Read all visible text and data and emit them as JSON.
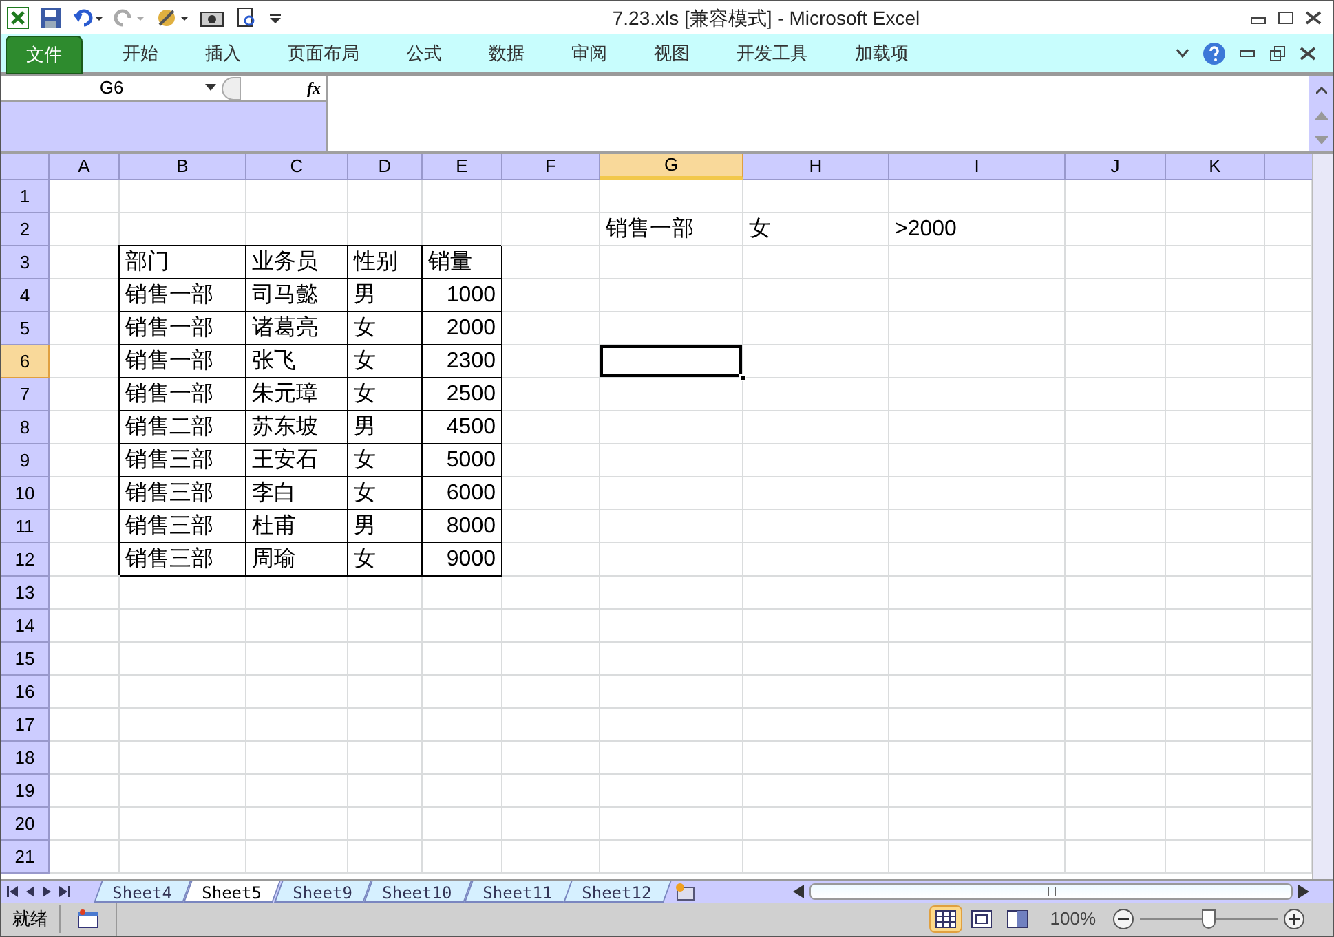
{
  "window": {
    "title": "7.23.xls  [兼容模式]  -  Microsoft Excel"
  },
  "ribbon": {
    "tabs": [
      {
        "label": "文件",
        "kind": "file"
      },
      {
        "label": "开始",
        "kind": "tab"
      },
      {
        "label": "插入",
        "kind": "tab"
      },
      {
        "label": "页面布局",
        "kind": "tab"
      },
      {
        "label": "公式",
        "kind": "tab"
      },
      {
        "label": "数据",
        "kind": "tab"
      },
      {
        "label": "审阅",
        "kind": "tab"
      },
      {
        "label": "视图",
        "kind": "tab"
      },
      {
        "label": "开发工具",
        "kind": "tab"
      },
      {
        "label": "加载项",
        "kind": "tab"
      }
    ]
  },
  "formula_bar": {
    "name_box": "G6",
    "fx": "fx"
  },
  "sheet": {
    "columns": [
      {
        "label": "A",
        "selected": false
      },
      {
        "label": "B",
        "selected": false
      },
      {
        "label": "C",
        "selected": false
      },
      {
        "label": "D",
        "selected": false
      },
      {
        "label": "E",
        "selected": false
      },
      {
        "label": "F",
        "selected": false
      },
      {
        "label": "G",
        "selected": true
      },
      {
        "label": "H",
        "selected": false
      },
      {
        "label": "I",
        "selected": false
      },
      {
        "label": "J",
        "selected": false
      },
      {
        "label": "K",
        "selected": false
      }
    ],
    "rows": [
      {
        "header": "1",
        "selected": false,
        "cells": []
      },
      {
        "header": "2",
        "selected": false,
        "cells": [
          "",
          "",
          "",
          "",
          "",
          "",
          {
            "text": "销售一部",
            "kind": "text",
            "bordered": false
          },
          {
            "text": "女",
            "kind": "text",
            "bordered": false
          },
          {
            "text": ">2000",
            "kind": "text",
            "bordered": false
          }
        ]
      },
      {
        "header": "3",
        "selected": false,
        "cells": [
          "",
          {
            "text": "部门",
            "kind": "text",
            "bordered": true
          },
          {
            "text": "业务员",
            "kind": "text",
            "bordered": true
          },
          {
            "text": "性别",
            "kind": "text",
            "bordered": true
          },
          {
            "text": "销量",
            "kind": "text",
            "bordered": true
          }
        ]
      },
      {
        "header": "4",
        "selected": false,
        "cells": [
          "",
          {
            "text": "销售一部",
            "kind": "text",
            "bordered": true
          },
          {
            "text": "司马懿",
            "kind": "text",
            "bordered": true
          },
          {
            "text": "男",
            "kind": "text",
            "bordered": true
          },
          {
            "text": "1000",
            "kind": "number",
            "bordered": true
          }
        ]
      },
      {
        "header": "5",
        "selected": false,
        "cells": [
          "",
          {
            "text": "销售一部",
            "kind": "text",
            "bordered": true
          },
          {
            "text": "诸葛亮",
            "kind": "text",
            "bordered": true
          },
          {
            "text": "女",
            "kind": "text",
            "bordered": true
          },
          {
            "text": "2000",
            "kind": "number",
            "bordered": true
          }
        ]
      },
      {
        "header": "6",
        "selected": true,
        "cells": [
          "",
          {
            "text": "销售一部",
            "kind": "text",
            "bordered": true
          },
          {
            "text": "张飞",
            "kind": "text",
            "bordered": true
          },
          {
            "text": "女",
            "kind": "text",
            "bordered": true
          },
          {
            "text": "2300",
            "kind": "number",
            "bordered": true
          }
        ]
      },
      {
        "header": "7",
        "selected": false,
        "cells": [
          "",
          {
            "text": "销售一部",
            "kind": "text",
            "bordered": true
          },
          {
            "text": "朱元璋",
            "kind": "text",
            "bordered": true
          },
          {
            "text": "女",
            "kind": "text",
            "bordered": true
          },
          {
            "text": "2500",
            "kind": "number",
            "bordered": true
          }
        ]
      },
      {
        "header": "8",
        "selected": false,
        "cells": [
          "",
          {
            "text": "销售二部",
            "kind": "text",
            "bordered": true
          },
          {
            "text": "苏东坡",
            "kind": "text",
            "bordered": true
          },
          {
            "text": "男",
            "kind": "text",
            "bordered": true
          },
          {
            "text": "4500",
            "kind": "number",
            "bordered": true
          }
        ]
      },
      {
        "header": "9",
        "selected": false,
        "cells": [
          "",
          {
            "text": "销售三部",
            "kind": "text",
            "bordered": true
          },
          {
            "text": "王安石",
            "kind": "text",
            "bordered": true
          },
          {
            "text": "女",
            "kind": "text",
            "bordered": true
          },
          {
            "text": "5000",
            "kind": "number",
            "bordered": true
          }
        ]
      },
      {
        "header": "10",
        "selected": false,
        "cells": [
          "",
          {
            "text": "销售三部",
            "kind": "text",
            "bordered": true
          },
          {
            "text": "李白",
            "kind": "text",
            "bordered": true
          },
          {
            "text": "女",
            "kind": "text",
            "bordered": true
          },
          {
            "text": "6000",
            "kind": "number",
            "bordered": true
          }
        ]
      },
      {
        "header": "11",
        "selected": false,
        "cells": [
          "",
          {
            "text": "销售三部",
            "kind": "text",
            "bordered": true
          },
          {
            "text": "杜甫",
            "kind": "text",
            "bordered": true
          },
          {
            "text": "男",
            "kind": "text",
            "bordered": true
          },
          {
            "text": "8000",
            "kind": "number",
            "bordered": true
          }
        ]
      },
      {
        "header": "12",
        "selected": false,
        "cells": [
          "",
          {
            "text": "销售三部",
            "kind": "text",
            "bordered": true
          },
          {
            "text": "周瑜",
            "kind": "text",
            "bordered": true
          },
          {
            "text": "女",
            "kind": "text",
            "bordered": true
          },
          {
            "text": "9000",
            "kind": "number",
            "bordered": true
          }
        ]
      },
      {
        "header": "13",
        "selected": false,
        "cells": []
      },
      {
        "header": "14",
        "selected": false,
        "cells": []
      },
      {
        "header": "15",
        "selected": false,
        "cells": []
      },
      {
        "header": "16",
        "selected": false,
        "cells": []
      },
      {
        "header": "17",
        "selected": false,
        "cells": []
      },
      {
        "header": "18",
        "selected": false,
        "cells": []
      },
      {
        "header": "19",
        "selected": false,
        "cells": []
      },
      {
        "header": "20",
        "selected": false,
        "cells": []
      },
      {
        "header": "21",
        "selected": false,
        "cells": []
      }
    ]
  },
  "sheet_tabs": [
    {
      "label": "Sheet4",
      "selected": false
    },
    {
      "label": "Sheet5",
      "selected": true
    },
    {
      "label": "Sheet9",
      "selected": false
    },
    {
      "label": "Sheet10",
      "selected": false
    },
    {
      "label": "Sheet11",
      "selected": false
    },
    {
      "label": "Sheet12",
      "selected": false
    }
  ],
  "status_bar": {
    "status": "就绪",
    "views": [
      {
        "kind": "normal",
        "selected": true
      },
      {
        "kind": "layout",
        "selected": false
      },
      {
        "kind": "pagebreak",
        "selected": false
      }
    ],
    "zoom": "100%",
    "zoom_slider": {
      "level": 0.5
    }
  }
}
